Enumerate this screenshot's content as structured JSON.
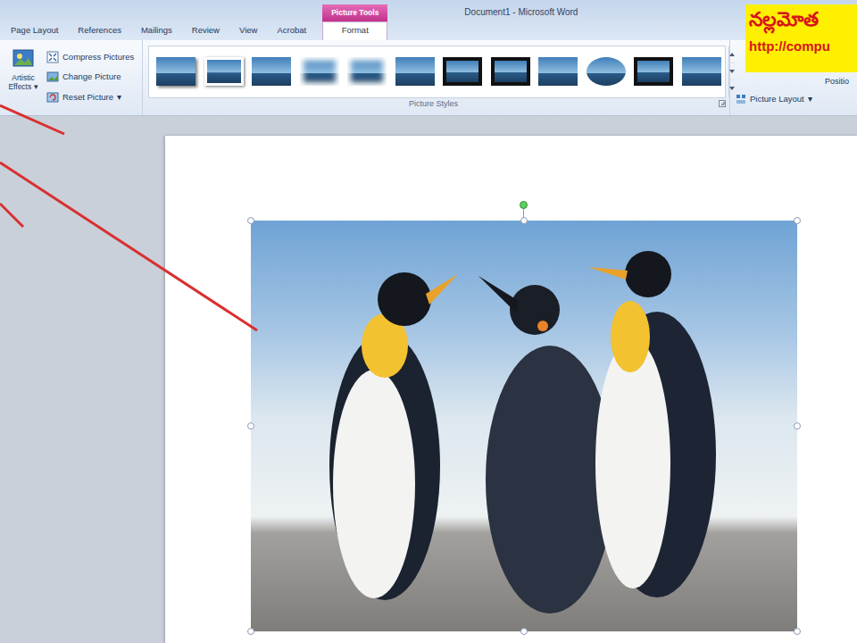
{
  "window": {
    "title": "Document1 - Microsoft Word"
  },
  "tabs": [
    {
      "label": "Page Layout",
      "selected": false
    },
    {
      "label": "References",
      "selected": false
    },
    {
      "label": "Mailings",
      "selected": false
    },
    {
      "label": "Review",
      "selected": false
    },
    {
      "label": "View",
      "selected": false
    },
    {
      "label": "Acrobat",
      "selected": false
    },
    {
      "label": "Format",
      "selected": true,
      "group": "Picture Tools"
    }
  ],
  "adjust": {
    "artistic_effects": {
      "label": "Artistic Effects",
      "arrow": "▾"
    },
    "items": [
      {
        "label": "Compress Pictures",
        "arrow": ""
      },
      {
        "label": "Change Picture",
        "arrow": ""
      },
      {
        "label": "Reset Picture",
        "arrow": "▾"
      }
    ]
  },
  "picture_styles": {
    "label": "Picture Styles",
    "thumbnails": [
      {
        "kind": "shadow"
      },
      {
        "kind": "white-frame"
      },
      {
        "kind": "plain"
      },
      {
        "kind": "soft-edge"
      },
      {
        "kind": "soft-edge"
      },
      {
        "kind": "plain"
      },
      {
        "kind": "black-frame"
      },
      {
        "kind": "black-frame"
      },
      {
        "kind": "plain"
      },
      {
        "kind": "oval"
      },
      {
        "kind": "black-frame"
      },
      {
        "kind": "plain"
      }
    ]
  },
  "arrange": {
    "picture_layout": {
      "label": "Picture Layout",
      "arrow": "▾"
    },
    "position": {
      "label": "Positio"
    }
  },
  "logo": {
    "text": "నల్లమోత",
    "url": "http://compu"
  },
  "picture": {
    "selected": true
  }
}
